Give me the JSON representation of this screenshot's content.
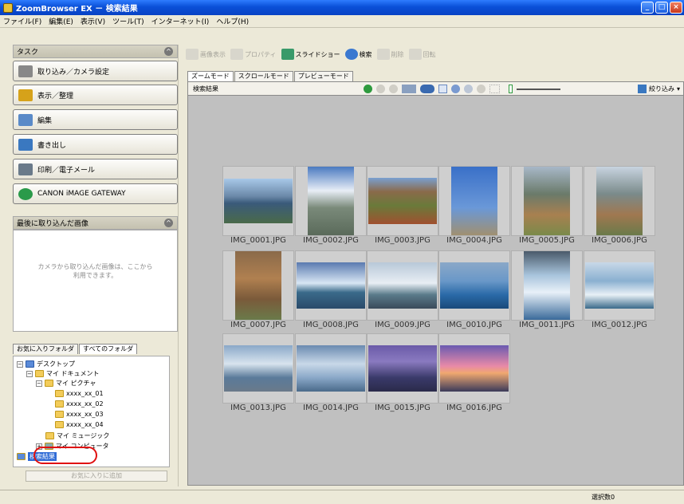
{
  "window": {
    "title": "ZoomBrowser EX － 検索結果"
  },
  "menu": [
    "ファイル(F)",
    "編集(E)",
    "表示(V)",
    "ツール(T)",
    "インターネット(I)",
    "ヘルプ(H)"
  ],
  "tasks": {
    "header": "タスク",
    "items": [
      "取り込み／カメラ設定",
      "表示／整理",
      "編集",
      "書き出し",
      "印刷／電子メール",
      "CANON iMAGE GATEWAY"
    ]
  },
  "recent": {
    "header": "最後に取り込んだ画像",
    "message_line1": "カメラから取り込んだ画像は、ここから",
    "message_line2": "利用できます。"
  },
  "folders": {
    "tab_favorites": "お気に入りフォルダ",
    "tab_all": "すべてのフォルダ",
    "add_favorite": "お気に入りに追加",
    "tree": [
      "デスクトップ",
      "マイ ドキュメント",
      "マイ ピクチャ",
      "xxxx_xx_01",
      "xxxx_xx_02",
      "xxxx_xx_03",
      "xxxx_xx_04",
      "マイ ミュージック",
      "マイ コンピュータ",
      "検索結果"
    ]
  },
  "toolbar": {
    "view": "画像表示",
    "properties": "プロパティ",
    "slideshow": "スライドショー",
    "search": "検索",
    "delete": "削除",
    "rotate": "回転"
  },
  "modes": {
    "zoom": "ズームモード",
    "scroll": "スクロールモード",
    "preview": "プレビューモード"
  },
  "view": {
    "label": "検索結果",
    "filter": "絞り込み"
  },
  "thumbnails": [
    "IMG_0001.JPG",
    "IMG_0002.JPG",
    "IMG_0003.JPG",
    "IMG_0004.JPG",
    "IMG_0005.JPG",
    "IMG_0006.JPG",
    "IMG_0007.JPG",
    "IMG_0008.JPG",
    "IMG_0009.JPG",
    "IMG_0010.JPG",
    "IMG_0011.JPG",
    "IMG_0012.JPG",
    "IMG_0013.JPG",
    "IMG_0014.JPG",
    "IMG_0015.JPG",
    "IMG_0016.JPG"
  ],
  "status": {
    "selected": "選択数0"
  },
  "colors": {
    "title_bar": "#0a50d8",
    "highlight": "#e01010",
    "selection": "#2f6bd6"
  }
}
